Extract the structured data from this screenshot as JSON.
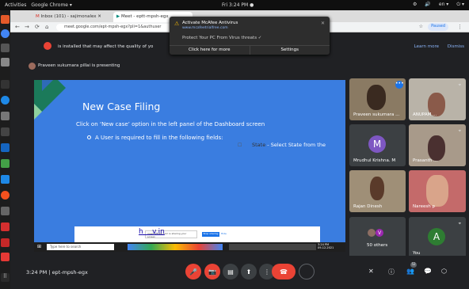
{
  "system": {
    "activities": "Activities",
    "app_name": "Google Chrome ▾",
    "clock": "Fri  3:24 PM ●",
    "tray": [
      "⚙",
      "🔊",
      "en ▾",
      "⏻ ▾"
    ]
  },
  "browser": {
    "tabs": [
      {
        "label": "Inbox (101) - sajimonalex"
      },
      {
        "label": "Meet - eptt-mpsh-egx"
      }
    ],
    "url": "meet.google.com/ept-mpsh-egx?pli=1&authuser",
    "profile_badge": "Paused",
    "infobar_message": "is installed that may affect the quality of yo",
    "infobar_learn_more": "Learn more",
    "infobar_dismiss": "Dismiss"
  },
  "notification": {
    "title": "Activate McAfee Antivirus",
    "link": "www.mcafeetrialfree.com",
    "body": "Protect Your PC From Virus threats ✓",
    "action1": "Click here for more",
    "action2": "Settings"
  },
  "meet": {
    "presenting": "Praveen sukumara pillai is presenting",
    "meeting_time": "3:24 PM",
    "meeting_code": "ept-mpsh-egx",
    "separator": "|"
  },
  "slide": {
    "title": "New Case Filing",
    "line1": "Click on ‘New case’ option in the left panel of the Dashboard screen",
    "line2": "A User is required to fill in the following fields:",
    "line3_label": "State",
    "line3_rest": "- Select State from the",
    "footer_link": "h    v.in",
    "popup_text": "meet.google.com is sharing your screen",
    "popup_button": "Stop sharing",
    "popup_hide": "Hide"
  },
  "taskbar": {
    "search": "Type here to search",
    "time": "3:24 PM",
    "date": "09-12-2021"
  },
  "participants": [
    {
      "name": "Praveen sukumara ...",
      "kind": "video"
    },
    {
      "name": "ANUPAM ...",
      "kind": "video"
    },
    {
      "name": "Mrudhul Krishna. M",
      "kind": "avatar",
      "initial": "M",
      "color": "#7e57c2"
    },
    {
      "name": "Prasanth ...",
      "kind": "video"
    },
    {
      "name": "Rajan Dinesh",
      "kind": "video"
    },
    {
      "name": "Nareesh p",
      "kind": "video"
    },
    {
      "name": "50 others",
      "kind": "others",
      "initial": "V"
    },
    {
      "name": "You",
      "kind": "avatar",
      "initial": "A",
      "color": "#2e7d32"
    }
  ],
  "controls": {
    "mic": "🎤",
    "cam": "📷",
    "cc": "▤",
    "present": "⬆",
    "more": "⋮",
    "hangup": "☎",
    "info": "ⓘ",
    "people": "👥",
    "people_count": "52",
    "chat": "💬",
    "activities": "⬡"
  },
  "colors": {
    "meet_bg": "#202124",
    "slide_blue": "#3a7de0",
    "hangup_red": "#ea4335",
    "accent_blue": "#8ab4f8"
  }
}
